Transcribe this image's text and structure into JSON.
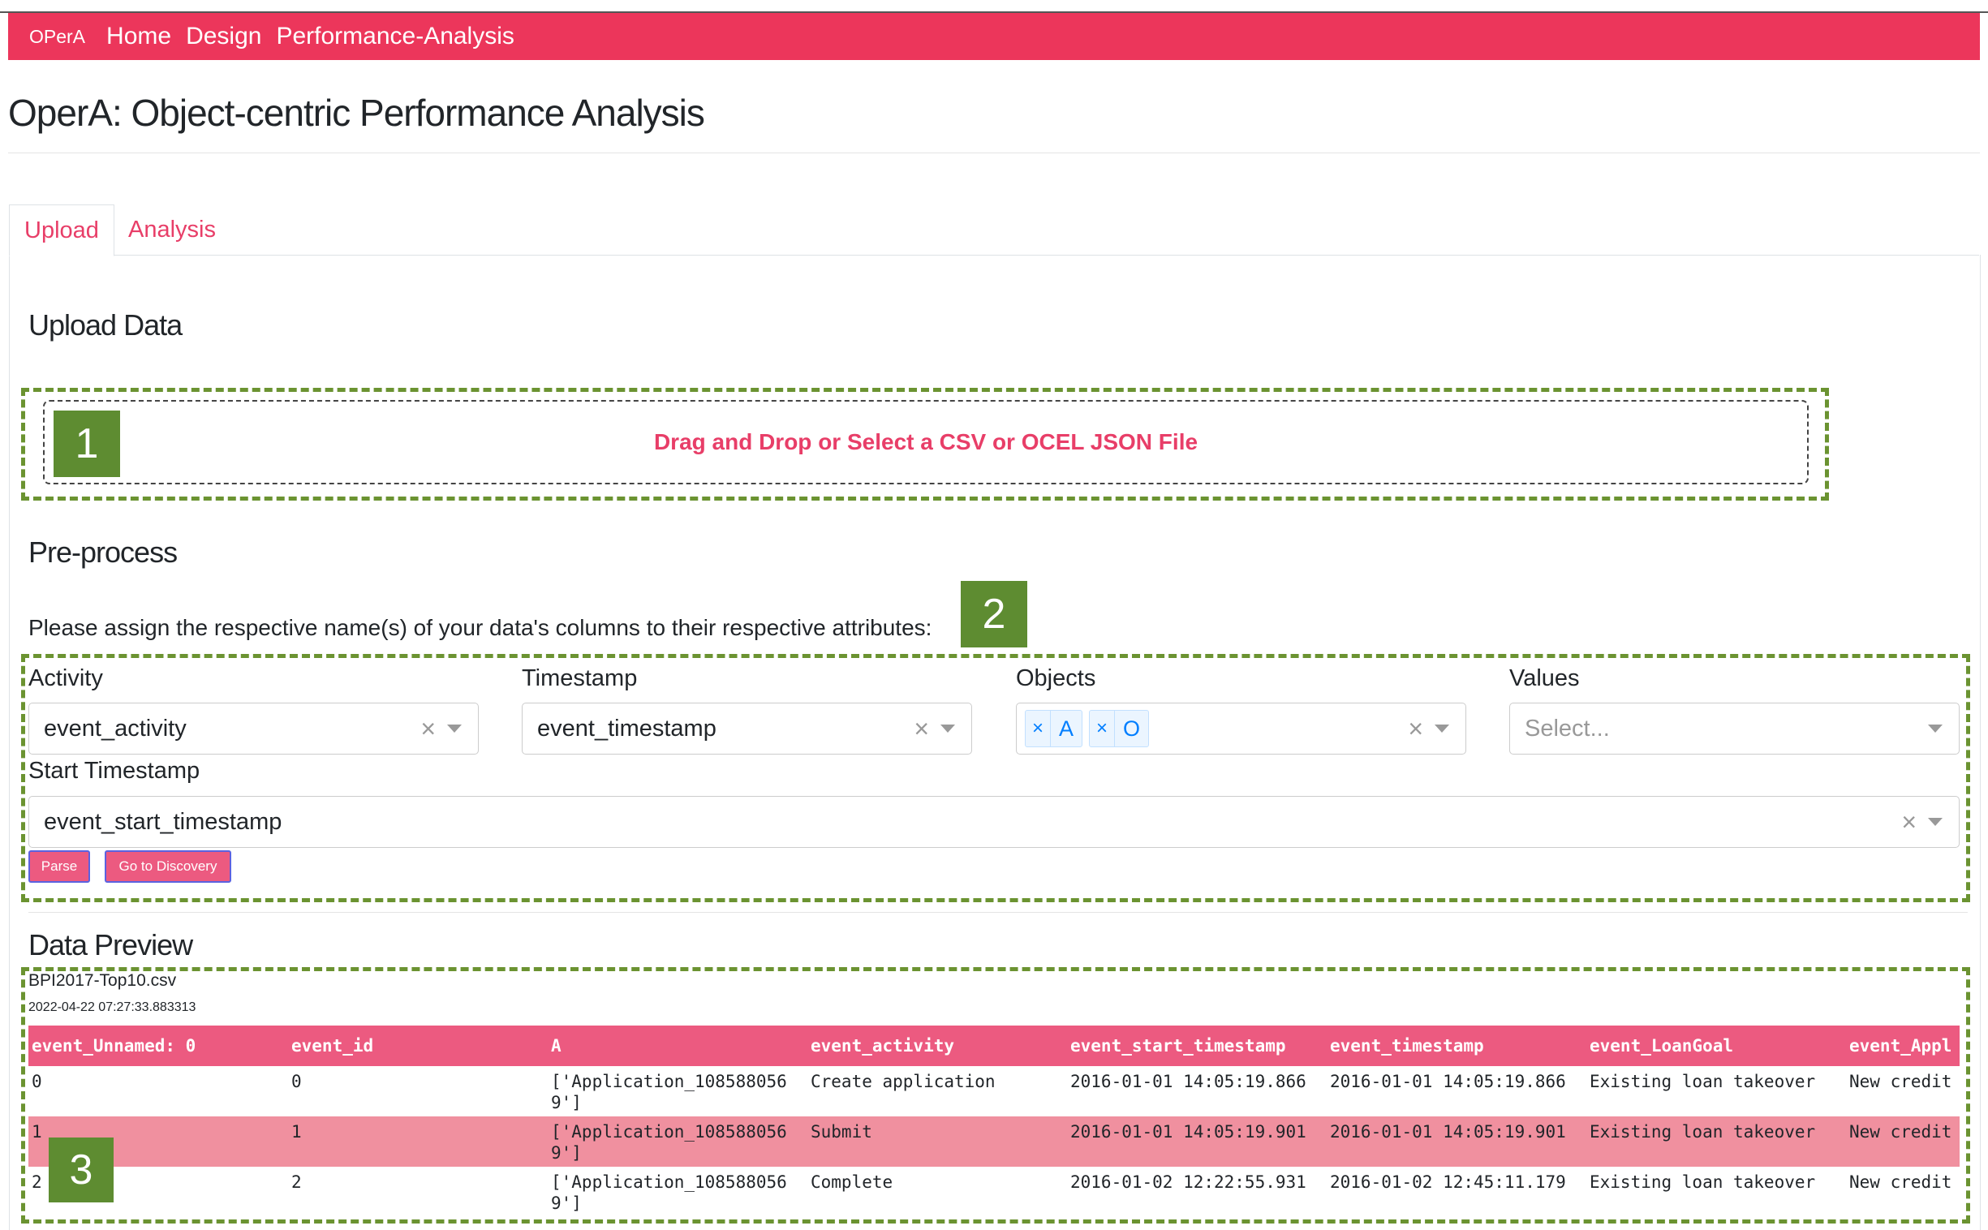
{
  "navbar": {
    "brand": "OPerA",
    "links": [
      "Home",
      "Design",
      "Performance-Analysis"
    ]
  },
  "page_title": "OperA: Object-centric Performance Analysis",
  "tabs": [
    "Upload",
    "Analysis"
  ],
  "upload": {
    "heading": "Upload Data",
    "dropzone_text": "Drag and Drop or Select a CSV or OCEL JSON File"
  },
  "preprocess": {
    "heading": "Pre-process",
    "instruction": "Please assign the respective name(s) of your data's columns to their respective attributes:",
    "fields": {
      "activity": {
        "label": "Activity",
        "value": "event_activity"
      },
      "timestamp": {
        "label": "Timestamp",
        "value": "event_timestamp"
      },
      "objects": {
        "label": "Objects",
        "chips": [
          "A",
          "O"
        ]
      },
      "values": {
        "label": "Values",
        "placeholder": "Select..."
      },
      "start_timestamp": {
        "label": "Start Timestamp",
        "value": "event_start_timestamp"
      }
    },
    "buttons": {
      "parse": "Parse",
      "discovery": "Go to Discovery"
    }
  },
  "preview": {
    "heading": "Data Preview",
    "file_name": "BPI2017-Top10.csv",
    "file_date": "2022-04-22 07:27:33.883313",
    "columns": [
      "event_Unnamed: 0",
      "event_id",
      "A",
      "event_activity",
      "event_start_timestamp",
      "event_timestamp",
      "event_LoanGoal",
      "event_Appl"
    ],
    "rows": [
      [
        "0",
        "0",
        "['Application_1085880569']",
        "Create application",
        "2016-01-01 14:05:19.866",
        "2016-01-01 14:05:19.866",
        "Existing loan takeover",
        "New credit"
      ],
      [
        "1",
        "1",
        "['Application_1085880569']",
        "Submit",
        "2016-01-01 14:05:19.901",
        "2016-01-01 14:05:19.901",
        "Existing loan takeover",
        "New credit"
      ],
      [
        "2",
        "2",
        "['Application_1085880569']",
        "Complete",
        "2016-01-02 12:22:55.931",
        "2016-01-02 12:45:11.179",
        "Existing loan takeover",
        "New credit"
      ]
    ]
  },
  "annotations": [
    "1",
    "2",
    "3"
  ],
  "colors": {
    "brand": "#ec365b",
    "accent": "#e83e68",
    "table_header": "#ec5a80",
    "annotation": "#5e8c31"
  },
  "icons": {
    "clear": "close-icon",
    "dropdown": "chevron-down-icon"
  }
}
